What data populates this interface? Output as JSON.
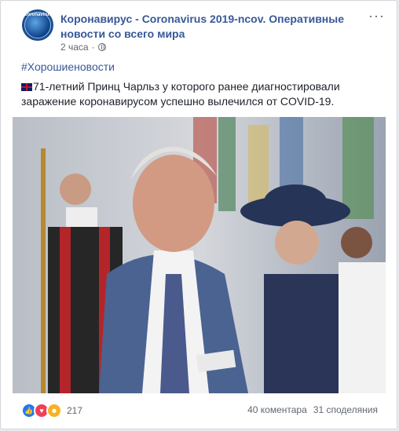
{
  "post": {
    "page_name": "Коронавирус - Coronavirus 2019-ncov. Оперативные новости со всего мира",
    "avatar_text": "Coronavirus",
    "time": "2 часа",
    "time_separator": "·",
    "hashtag": "#Хорошиеновости",
    "text": "71-летний Принц Чарльз у которого ранее диагностировали заражение коронавирусом успешно вылечился от COVID-19.",
    "more_label": "···"
  },
  "footer": {
    "reaction_count": "217",
    "comments": "40 коментара",
    "shares": "31 споделяния"
  },
  "icons": [
    "gear-globe-avatar",
    "globe-icon",
    "uk-flag-icon",
    "like-icon",
    "love-icon",
    "haha-icon",
    "more-icon"
  ],
  "colors": {
    "link": "#385898",
    "text": "#1d2129",
    "meta": "#616770",
    "like": "#2078f4",
    "love": "#f33e58",
    "haha": "#f7b125"
  }
}
